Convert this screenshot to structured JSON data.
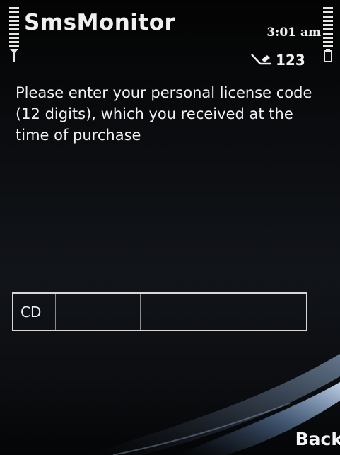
{
  "app": {
    "title": "SmsMonitor"
  },
  "status_bar": {
    "time": "3:01 am",
    "input_mode": "123",
    "signal_icon": "antenna-icon",
    "battery_icon": "battery-icon",
    "input_icon": "pencil-icon"
  },
  "prompt": {
    "text": "Please enter your personal license code (12 digits), which you received at the time of purchase"
  },
  "license_field": {
    "prefix": "CD",
    "segments": [
      "",
      "",
      ""
    ]
  },
  "softkeys": {
    "right_label": "Back"
  },
  "colors": {
    "background": "#0b0d10",
    "text": "#f0f0f0",
    "field_border": "#d8d8d8",
    "swoosh": "#8fb4dc"
  }
}
